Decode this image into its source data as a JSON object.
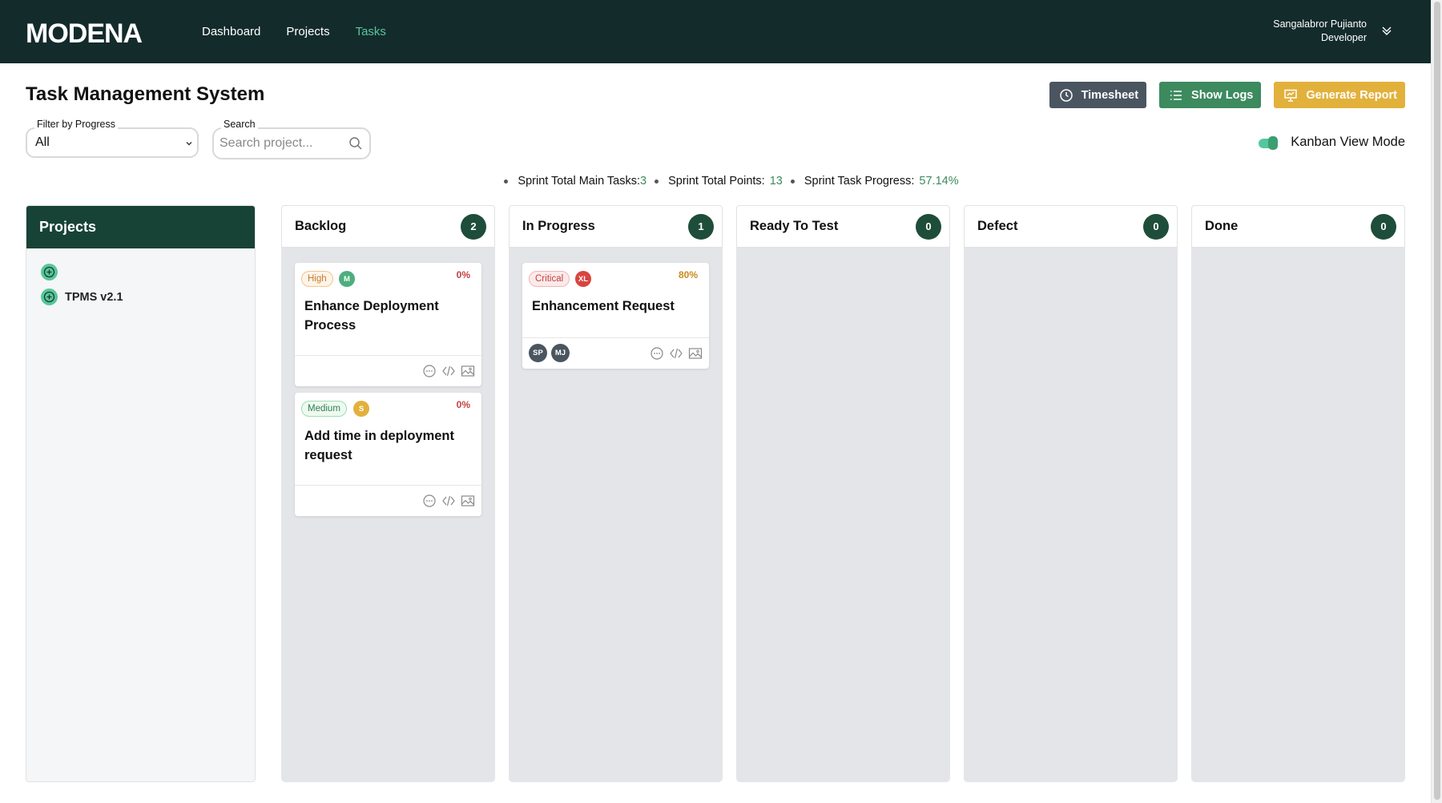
{
  "app": {
    "logo_text": "MODENA",
    "nav": [
      {
        "label": "Dashboard"
      },
      {
        "label": "Projects"
      },
      {
        "label": "Tasks",
        "active": true
      }
    ],
    "user": {
      "name": "Sangalabror Pujianto",
      "role": "Developer"
    }
  },
  "page": {
    "title": "Task Management System"
  },
  "actions": {
    "timesheet_label": "Timesheet",
    "show_logs_label": "Show Logs",
    "generate_report_label": "Generate Report"
  },
  "filters": {
    "progress_label": "Filter by Progress",
    "progress_value": "All",
    "search_label": "Search",
    "search_placeholder": "Search project..."
  },
  "view_toggle": {
    "label": "Kanban View Mode",
    "on": true
  },
  "sprint_stats": {
    "main_tasks_label": "Sprint Total Main Tasks:",
    "main_tasks_value": "3",
    "points_label": "Sprint Total Points:",
    "points_value": "13",
    "progress_label": "Sprint Task Progress:",
    "progress_value": "57.14%"
  },
  "projects_panel": {
    "title": "Projects",
    "items": [
      {
        "label": ""
      },
      {
        "label": "TPMS v2.1"
      }
    ]
  },
  "columns": [
    {
      "title": "Backlog",
      "count": "2",
      "cards": [
        {
          "priority": "High",
          "size": "M",
          "size_color": "#4caf7d",
          "progress": "0%",
          "progress_color": "#c43f3f",
          "title": "Enhance Deployment Process",
          "assignees": []
        },
        {
          "priority": "Medium",
          "size": "S",
          "size_color": "#e2b13c",
          "progress": "0%",
          "progress_color": "#c43f3f",
          "title": "Add time in deployment request",
          "assignees": []
        }
      ]
    },
    {
      "title": "In Progress",
      "count": "1",
      "cards": [
        {
          "priority": "Critical",
          "size": "XL",
          "size_color": "#d9443f",
          "progress": "80%",
          "progress_color": "#c98a1f",
          "title": "Enhancement Request",
          "assignees": [
            "SP",
            "MJ"
          ]
        }
      ]
    },
    {
      "title": "Ready To Test",
      "count": "0",
      "cards": []
    },
    {
      "title": "Defect",
      "count": "0",
      "cards": []
    },
    {
      "title": "Done",
      "count": "0",
      "cards": []
    }
  ],
  "colors": {
    "nav_bg": "#142b2c",
    "accent_green": "#56c79b",
    "dark_green": "#1e4d3a",
    "timesheet_btn": "#4a5560",
    "logs_btn": "#3d8a5f",
    "report_btn": "#e2b13c"
  }
}
